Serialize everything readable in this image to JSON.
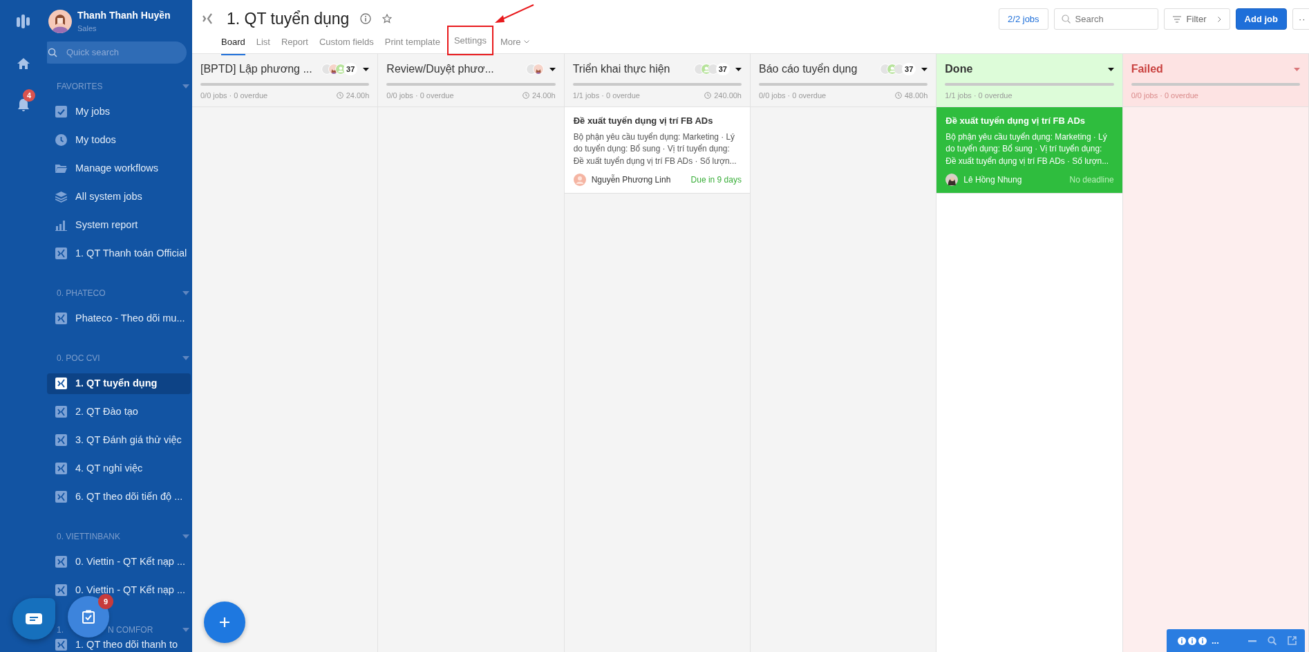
{
  "rail": {
    "notifications_badge": "4"
  },
  "profile": {
    "name": "Thanh Thanh Huyền",
    "role": "Sales"
  },
  "quick_search": {
    "placeholder": "Quick search"
  },
  "sidebar": {
    "sections": [
      {
        "label_parts": [
          "FAVORITES"
        ],
        "items": [
          {
            "kind": "check",
            "label": "My jobs",
            "selected": false
          },
          {
            "kind": "clock",
            "label": "My todos",
            "selected": false
          },
          {
            "kind": "folder",
            "label": "Manage workflows",
            "selected": false
          },
          {
            "kind": "layers",
            "label": "All system jobs",
            "selected": false
          },
          {
            "kind": "chart",
            "label": "System report",
            "selected": false
          },
          {
            "kind": "workflow",
            "label": "1. QT Thanh toán Official",
            "selected": false
          }
        ]
      },
      {
        "label_parts": [
          "0. PHATECO"
        ],
        "items": [
          {
            "kind": "workflow",
            "label": "Phateco - Theo dõi mu...",
            "selected": false
          }
        ]
      },
      {
        "label_parts": [
          "0. POC CVI"
        ],
        "items": [
          {
            "kind": "workflow",
            "label": "1. QT tuyển dụng",
            "selected": true
          },
          {
            "kind": "workflow",
            "label": "2. QT Đào tạo",
            "selected": false
          },
          {
            "kind": "workflow",
            "label": "3. QT Đánh giá thử việc",
            "selected": false
          },
          {
            "kind": "workflow",
            "label": "4. QT nghỉ việc",
            "selected": false
          },
          {
            "kind": "workflow",
            "label": "6. QT theo dõi tiến độ ...",
            "selected": false
          }
        ]
      },
      {
        "label_parts": [
          "0. VIETTINBANK"
        ],
        "items": [
          {
            "kind": "workflow",
            "label": "0. Viettin - QT Kết nạp ...",
            "selected": false
          },
          {
            "kind": "workflow",
            "label": "0. Viettin - QT Kết nạp ...",
            "selected": false
          }
        ]
      },
      {
        "label_parts": [
          "1.",
          "N COMFOR"
        ],
        "items": [
          {
            "kind": "workflow",
            "label": "1. QT theo dõi thanh to",
            "selected": false
          }
        ]
      }
    ]
  },
  "floating": {
    "tasks_badge": "9"
  },
  "header": {
    "title": "1. QT tuyển dụng",
    "tabs": [
      {
        "label": "Board",
        "selected": true,
        "highlighted": false,
        "kind": "tab"
      },
      {
        "label": "List",
        "selected": false,
        "highlighted": false,
        "kind": "tab"
      },
      {
        "label": "Report",
        "selected": false,
        "highlighted": false,
        "kind": "tab"
      },
      {
        "label": "Custom fields",
        "selected": false,
        "highlighted": false,
        "kind": "tab"
      },
      {
        "label": "Print template",
        "selected": false,
        "highlighted": false,
        "kind": "tab"
      },
      {
        "label": "Settings",
        "selected": false,
        "highlighted": true,
        "kind": "tab"
      },
      {
        "label": "More",
        "selected": false,
        "highlighted": false,
        "kind": "menu"
      }
    ],
    "jobs_count": "2/2 jobs",
    "search": {
      "placeholder": "Search"
    },
    "filter": "Filter",
    "add_job": "Add job",
    "more": "··"
  },
  "columns": [
    {
      "title": "[BPTD] Lập phương ...",
      "kind": "default",
      "avatars": [
        {
          "kind": "blank"
        },
        {
          "kind": "figure"
        },
        {
          "kind": "green"
        }
      ],
      "count": "37",
      "stats": "0/0 jobs · 0 overdue",
      "time": "24.00h"
    },
    {
      "title": "Review/Duyệt phươ...",
      "kind": "default",
      "avatars": [
        {
          "kind": "blank"
        },
        {
          "kind": "figure"
        }
      ],
      "stats": "0/0 jobs · 0 overdue",
      "time": "24.00h"
    },
    {
      "title": "Triển khai thực hiện",
      "kind": "default",
      "avatars": [
        {
          "kind": "blank"
        },
        {
          "kind": "green"
        },
        {
          "kind": "blank"
        }
      ],
      "count": "37",
      "stats": "1/1 jobs · 0 overdue",
      "time": "240.00h",
      "cards": [
        {
          "title": "Đề xuất tuyển dụng vị trí FB ADs",
          "description": "Bộ phận yêu cầu tuyển dụng: Marketing · Lý do tuyển dụng: Bổ sung · Vị trí tuyển dụng: Đề xuất tuyển dụng vị trí FB ADs · Số lượn...",
          "assignee": {
            "name": "Nguyễn Phương Linh",
            "kind": "placeholder"
          },
          "due": "Due in 9 days",
          "has_deadline": true
        }
      ]
    },
    {
      "title": "Báo cáo tuyển dụng",
      "kind": "default",
      "avatars": [
        {
          "kind": "blank"
        },
        {
          "kind": "green"
        },
        {
          "kind": "blank"
        }
      ],
      "count": "37",
      "stats": "0/0 jobs · 0 overdue",
      "time": "48.00h"
    },
    {
      "title": "Done",
      "kind": "done",
      "stats": "1/1 jobs · 0 overdue",
      "cards": [
        {
          "title": "Đề xuất tuyển dụng vị trí FB ADs",
          "description": "Bộ phận yêu cầu tuyển dụng: Marketing · Lý do tuyển dụng: Bổ sung · Vị trí tuyển dụng: Đề xuất tuyển dụng vị trí FB ADs · Số lượn...",
          "assignee": {
            "name": "Lê Hồng Nhung",
            "kind": "photo"
          },
          "due": "No deadline",
          "has_deadline": false
        }
      ]
    },
    {
      "title": "Failed",
      "kind": "failed",
      "stats": "0/0 jobs · 0 overdue"
    }
  ],
  "chat_widget": {
    "label": "..."
  }
}
